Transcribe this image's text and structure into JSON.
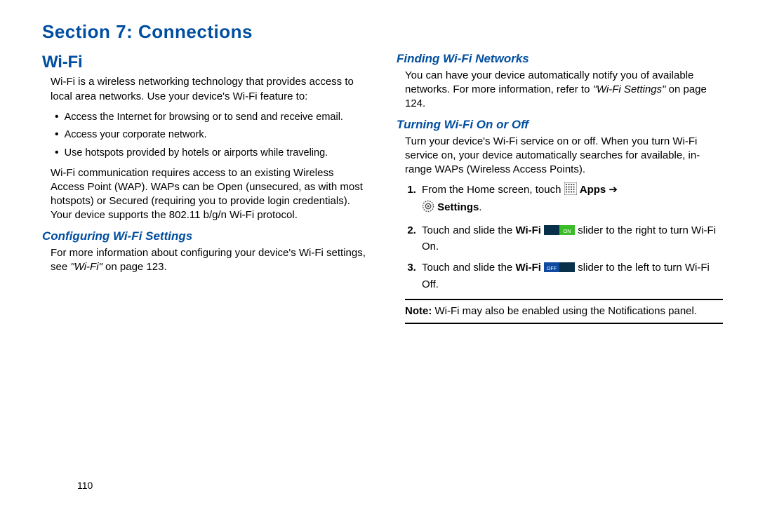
{
  "section_title": "Section 7: Connections",
  "page_number": "110",
  "left": {
    "heading": "Wi-Fi",
    "intro": "Wi-Fi is a wireless networking technology that provides access to local area networks. Use your device's Wi-Fi feature to:",
    "bullets": [
      "Access the Internet for browsing or to send and receive email.",
      "Access your corporate network.",
      "Use hotspots provided by hotels or airports while traveling."
    ],
    "body2": "Wi-Fi communication requires access to an existing Wireless Access Point (WAP). WAPs can be Open (unsecured, as with most hotspots) or Secured (requiring you to provide login credentials). Your device supports the 802.11 b/g/n Wi-Fi protocol.",
    "sub1_heading": "Configuring Wi-Fi Settings",
    "sub1_pre": "For more information about configuring your device's Wi-Fi settings, see ",
    "sub1_ref": "\"Wi-Fi\"",
    "sub1_post": " on page 123."
  },
  "right": {
    "sub1_heading": "Finding Wi-Fi Networks",
    "sub1_pre": "You can have your device automatically notify you of available networks. For more information, refer to ",
    "sub1_ref": "\"Wi-Fi Settings\"",
    "sub1_post": " on page 124.",
    "sub2_heading": "Turning Wi-Fi On or Off",
    "sub2_body": "Turn your device's Wi-Fi service on or off. When you turn Wi-Fi service on, your device automatically searches for available, in-range WAPs (Wireless Access Points).",
    "step1_pre": "From the Home screen, touch ",
    "step1_apps": "Apps",
    "step1_arrow": " ➔ ",
    "step1_settings": "Settings",
    "step1_dot": ".",
    "step2_pre": "Touch and slide the ",
    "step2_wifi": "Wi-Fi ",
    "step2_post": " slider to the right to turn Wi-Fi On.",
    "step3_pre": "Touch and slide the ",
    "step3_wifi": "Wi-Fi ",
    "step3_post": " slider to the left to turn Wi-Fi Off.",
    "note_label": "Note:",
    "note_text": " Wi-Fi may also be enabled using the Notifications panel."
  }
}
